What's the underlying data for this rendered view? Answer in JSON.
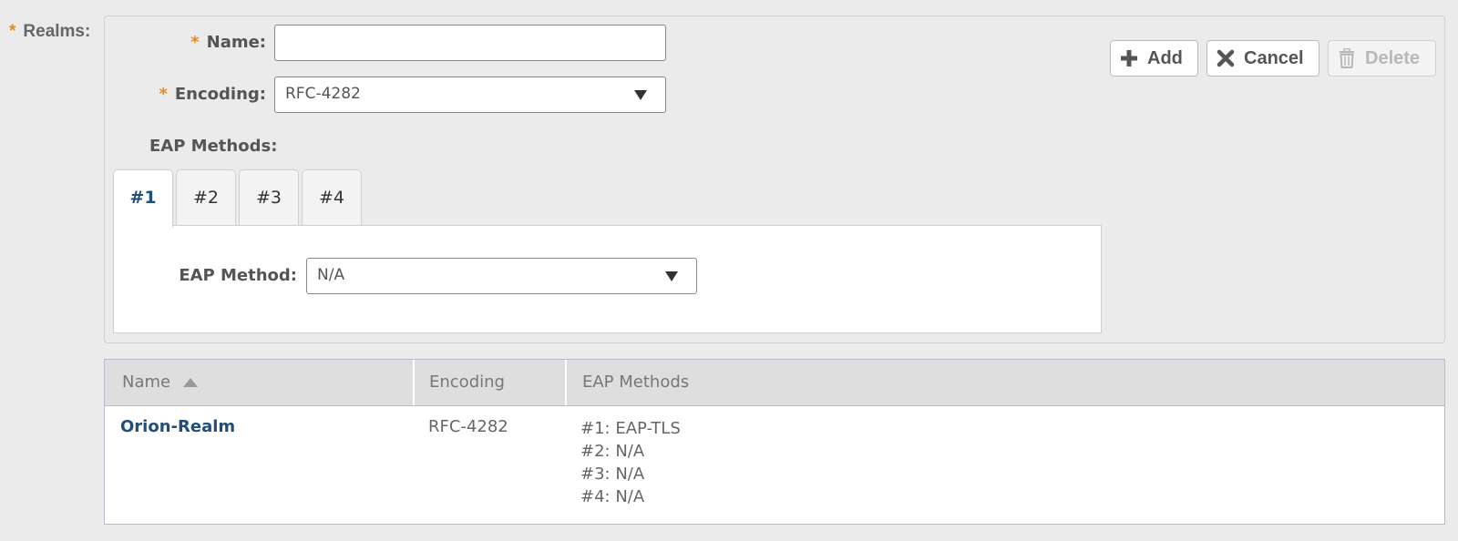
{
  "realms_label": "Realms:",
  "required_mark": "*",
  "form": {
    "name_label": "Name:",
    "name_value": "",
    "encoding_label": "Encoding:",
    "encoding_value": "RFC-4282",
    "eap_methods_label": "EAP Methods:",
    "tabs": [
      {
        "label": "#1",
        "active": true
      },
      {
        "label": "#2",
        "active": false
      },
      {
        "label": "#3",
        "active": false
      },
      {
        "label": "#4",
        "active": false
      }
    ],
    "eap_method_label": "EAP Method:",
    "eap_method_value": "N/A"
  },
  "buttons": {
    "add": "Add",
    "cancel": "Cancel",
    "delete": "Delete"
  },
  "table": {
    "columns": [
      "Name",
      "Encoding",
      "EAP Methods"
    ],
    "rows": [
      {
        "name": "Orion-Realm",
        "encoding": "RFC-4282",
        "eap_methods": [
          "#1: EAP-TLS",
          "#2: N/A",
          "#3: N/A",
          "#4: N/A"
        ]
      }
    ]
  },
  "colors": {
    "required": "#e8891c",
    "link": "#1f4f7a",
    "background": "#ebebeb"
  }
}
